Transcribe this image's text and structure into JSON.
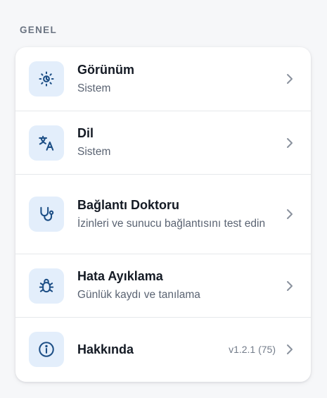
{
  "section": {
    "title": "GENEL"
  },
  "colors": {
    "icon_background": "#e3eefb",
    "icon_color": "#1d4f86",
    "chevron_color": "#8a929e",
    "title_color": "#141a24",
    "subtitle_color": "#5a6372"
  },
  "settings": {
    "appearance": {
      "title": "Görünüm",
      "subtitle": "Sistem",
      "icon": "sun-icon"
    },
    "language": {
      "title": "Dil",
      "subtitle": "Sistem",
      "icon": "translate-icon"
    },
    "connection_doctor": {
      "title": "Bağlantı Doktoru",
      "subtitle": "İzinleri ve sunucu bağlantısını test edin",
      "icon": "stethoscope-icon"
    },
    "debugging": {
      "title": "Hata Ayıklama",
      "subtitle": "Günlük kaydı ve tanılama",
      "icon": "bug-icon"
    },
    "about": {
      "title": "Hakkında",
      "version": "v1.2.1 (75)",
      "icon": "info-icon"
    }
  }
}
